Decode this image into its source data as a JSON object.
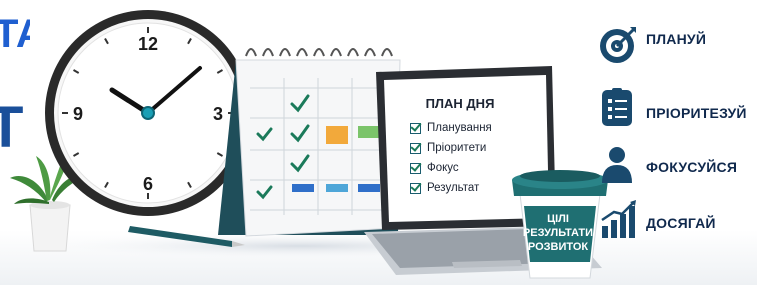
{
  "left_banner": {
    "line1_fragment": "ТА",
    "line2_fragment": "Т"
  },
  "clock": {
    "num_12": "12",
    "num_3": "3",
    "num_6": "6",
    "num_9": "9"
  },
  "laptop": {
    "title": "ПЛАН ДНЯ",
    "items": [
      "Планування",
      "Пріоритети",
      "Фокус",
      "Результат"
    ]
  },
  "cup": {
    "lines": [
      "ЦІЛІ",
      "РЕЗУЛЬТАТИ",
      "РОЗВИТОК"
    ]
  },
  "actions": [
    {
      "label": "ПЛАНУЙ",
      "icon": "target-icon"
    },
    {
      "label": "ПРІОРИТЕЗУЙ",
      "icon": "checklist-icon"
    },
    {
      "label": "ФОКУСУЙСЯ",
      "icon": "person-icon"
    },
    {
      "label": "ДОСЯГАЙ",
      "icon": "growth-chart-icon"
    }
  ],
  "colors": {
    "accent_blue": "#1f5fd0",
    "navy": "#10294d",
    "teal": "#1a5c6e",
    "check_green": "#1b7a5a"
  }
}
